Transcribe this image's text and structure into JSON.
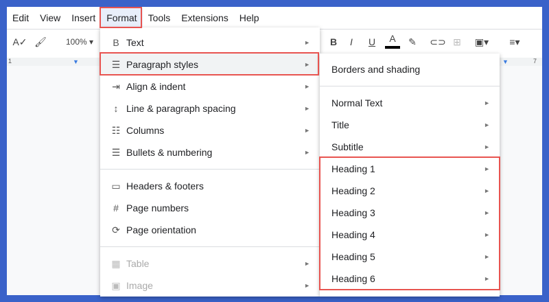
{
  "menubar": [
    "Edit",
    "View",
    "Insert",
    "Format",
    "Tools",
    "Extensions",
    "Help"
  ],
  "toolbar": {
    "zoom": "100%",
    "bold": "B",
    "italic": "I",
    "underline": "U",
    "text_color": "A"
  },
  "ruler": {
    "left": "1",
    "right": "7"
  },
  "format_menu": [
    {
      "label": "Text",
      "icon": "bold-icon",
      "glyph": "B",
      "arrow": true
    },
    {
      "label": "Paragraph styles",
      "icon": "paragraph-icon",
      "glyph": "☰",
      "arrow": true
    },
    {
      "label": "Align & indent",
      "icon": "indent-icon",
      "glyph": "⇥",
      "arrow": true
    },
    {
      "label": "Line & paragraph spacing",
      "icon": "line-spacing-icon",
      "glyph": "↕",
      "arrow": true
    },
    {
      "label": "Columns",
      "icon": "columns-icon",
      "glyph": "☷",
      "arrow": true
    },
    {
      "label": "Bullets & numbering",
      "icon": "bullets-icon",
      "glyph": "☰",
      "arrow": true
    },
    {
      "label": "Headers & footers",
      "icon": "header-footer-icon",
      "glyph": "▭",
      "arrow": false
    },
    {
      "label": "Page numbers",
      "icon": "hash-icon",
      "glyph": "#",
      "arrow": false
    },
    {
      "label": "Page orientation",
      "icon": "page-orientation-icon",
      "glyph": "⟳",
      "arrow": false
    },
    {
      "label": "Table",
      "icon": "table-icon",
      "glyph": "▦",
      "arrow": true,
      "disabled": true
    },
    {
      "label": "Image",
      "icon": "image-icon",
      "glyph": "▣",
      "arrow": true,
      "disabled": true
    }
  ],
  "submenu": [
    {
      "label": "Borders and shading",
      "arrow": false
    },
    {
      "label": "Normal Text",
      "arrow": true
    },
    {
      "label": "Title",
      "arrow": true
    },
    {
      "label": "Subtitle",
      "arrow": true
    },
    {
      "label": "Heading 1",
      "arrow": true
    },
    {
      "label": "Heading 2",
      "arrow": true
    },
    {
      "label": "Heading 3",
      "arrow": true
    },
    {
      "label": "Heading 4",
      "arrow": true
    },
    {
      "label": "Heading 5",
      "arrow": true
    },
    {
      "label": "Heading 6",
      "arrow": true
    }
  ],
  "arrow_glyph": "►"
}
